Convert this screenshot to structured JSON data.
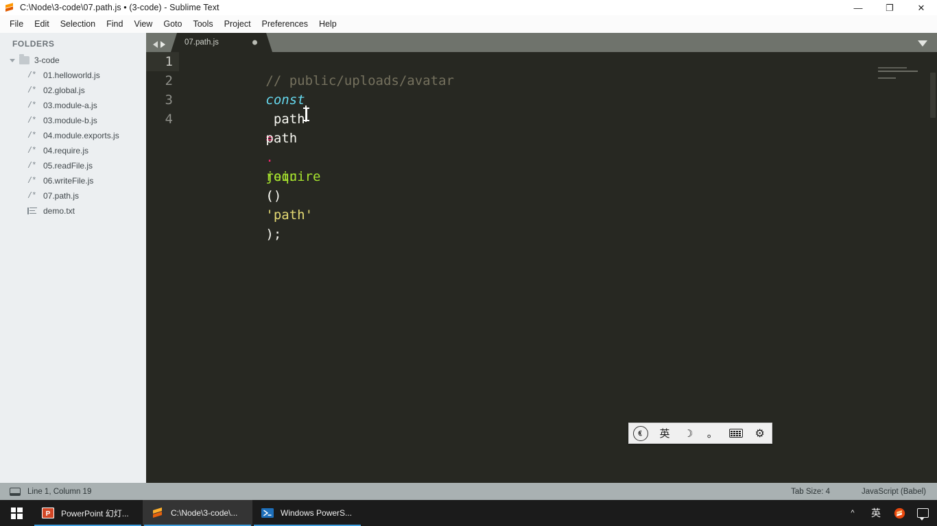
{
  "window": {
    "title": "C:\\Node\\3-code\\07.path.js • (3-code) - Sublime Text",
    "app_icon": "sublime-text-icon",
    "controls": {
      "minimize": "—",
      "restore": "❐",
      "close": "✕"
    }
  },
  "menubar": {
    "items": [
      {
        "label": "File"
      },
      {
        "label": "Edit"
      },
      {
        "label": "Selection"
      },
      {
        "label": "Find"
      },
      {
        "label": "View"
      },
      {
        "label": "Goto"
      },
      {
        "label": "Tools"
      },
      {
        "label": "Project"
      },
      {
        "label": "Preferences"
      },
      {
        "label": "Help"
      }
    ]
  },
  "sidebar": {
    "header": "FOLDERS",
    "folder": {
      "name": "3-code",
      "expanded": true,
      "icon": "folder-icon"
    },
    "files": [
      {
        "name": "01.helloworld.js",
        "icon": "js-file-icon",
        "glyph": "/*"
      },
      {
        "name": "02.global.js",
        "icon": "js-file-icon",
        "glyph": "/*"
      },
      {
        "name": "03.module-a.js",
        "icon": "js-file-icon",
        "glyph": "/*"
      },
      {
        "name": "03.module-b.js",
        "icon": "js-file-icon",
        "glyph": "/*"
      },
      {
        "name": "04.module.exports.js",
        "icon": "js-file-icon",
        "glyph": "/*"
      },
      {
        "name": "04.require.js",
        "icon": "js-file-icon",
        "glyph": "/*"
      },
      {
        "name": "05.readFile.js",
        "icon": "js-file-icon",
        "glyph": "/*"
      },
      {
        "name": "06.writeFile.js",
        "icon": "js-file-icon",
        "glyph": "/*"
      },
      {
        "name": "07.path.js",
        "icon": "js-file-icon",
        "glyph": "/*"
      },
      {
        "name": "demo.txt",
        "icon": "text-file-icon",
        "glyph": ""
      }
    ]
  },
  "editor": {
    "tabs": [
      {
        "label": "07.path.js",
        "dirty": true,
        "active": true
      }
    ],
    "lines": [
      {
        "number": "1",
        "active": true,
        "tokens": [
          {
            "text": "// public/uploads/avatar",
            "kind": "comment"
          }
        ]
      },
      {
        "number": "2",
        "active": false,
        "tokens": [
          {
            "text": "const",
            "kind": "kw"
          },
          {
            "text": " path ",
            "kind": "plain"
          },
          {
            "text": "=",
            "kind": "op"
          },
          {
            "text": " ",
            "kind": "plain"
          },
          {
            "text": "require",
            "kind": "fn"
          },
          {
            "text": "(",
            "kind": "punc"
          },
          {
            "text": "'path'",
            "kind": "str"
          },
          {
            "text": ");",
            "kind": "punc"
          }
        ]
      },
      {
        "number": "3",
        "active": false,
        "tokens": []
      },
      {
        "number": "4",
        "active": false,
        "tokens": [
          {
            "text": "path",
            "kind": "plain"
          },
          {
            "text": ".",
            "kind": "op"
          },
          {
            "text": "join",
            "kind": "fn"
          },
          {
            "text": "()",
            "kind": "punc"
          }
        ]
      }
    ],
    "colors": {
      "background": "#272822",
      "comment": "#75715e",
      "keyword": "#66d9ef",
      "operator": "#f92672",
      "function": "#a6e22e",
      "string": "#e6db74",
      "plain": "#f8f8f2",
      "gutter_text": "#8f908a",
      "active_line": "#32332c",
      "tabbar": "#6f736c"
    }
  },
  "ime_toolbar": {
    "items": [
      {
        "name": "sogou-logo-icon",
        "glyph": ""
      },
      {
        "name": "language-mode",
        "glyph": "英"
      },
      {
        "name": "moon-icon",
        "glyph": "☽"
      },
      {
        "name": "punctuation-mode-icon",
        "glyph": "。"
      },
      {
        "name": "keyboard-icon",
        "glyph": ""
      },
      {
        "name": "settings-gear-icon",
        "glyph": "⚙"
      }
    ]
  },
  "statusbar": {
    "cursor_position": "Line 1, Column 19",
    "tab_size": "Tab Size: 4",
    "syntax": "JavaScript (Babel)"
  },
  "taskbar": {
    "start": "start-button",
    "items": [
      {
        "label": "PowerPoint 幻灯...",
        "icon": "powerpoint-icon",
        "active": false,
        "accent": "#d24726"
      },
      {
        "label": "C:\\Node\\3-code\\...",
        "icon": "sublime-text-icon",
        "active": true,
        "accent": "#ff9800"
      },
      {
        "label": "Windows PowerS...",
        "icon": "powershell-icon",
        "active": false,
        "accent": "#1e6fba"
      }
    ],
    "tray": [
      {
        "name": "show-hidden-icons-chevron",
        "glyph": "^"
      },
      {
        "name": "ime-language-indicator",
        "glyph": "英"
      },
      {
        "name": "sublime-tray-icon",
        "glyph": ""
      },
      {
        "name": "notifications-icon",
        "glyph": ""
      }
    ]
  }
}
